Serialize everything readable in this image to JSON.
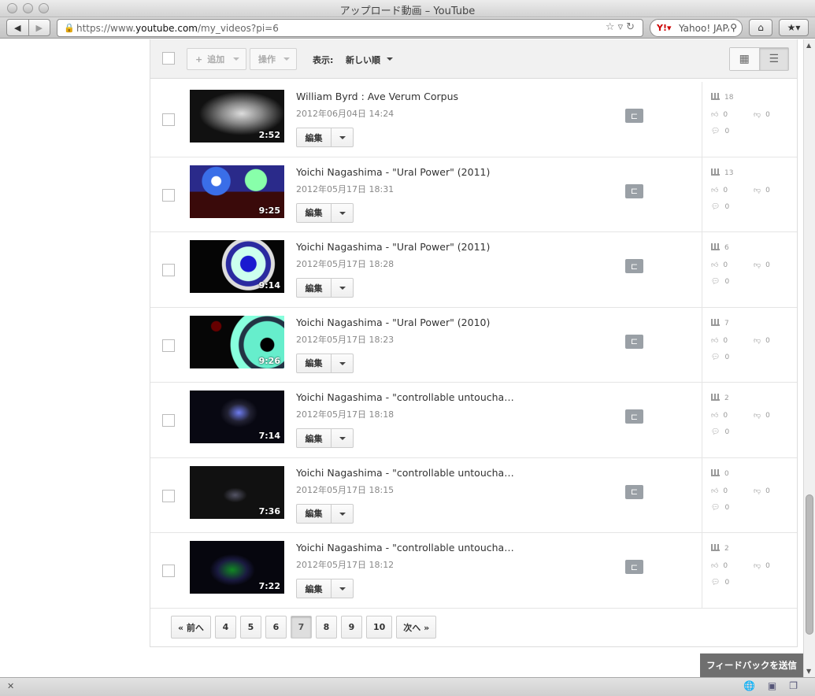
{
  "window": {
    "title": "アップロード動画 – YouTube",
    "url_prefix": "https://www.",
    "url_domain": "youtube.com",
    "url_path": "/my_videos?pi=6",
    "search_text": "Yahoo! JAPAN"
  },
  "toolbar": {
    "add_label": "追加",
    "actions_label": "操作",
    "sort_label": "表示:",
    "sort_value": "新しい順"
  },
  "videos": [
    {
      "title": "William Byrd : Ave Verum Corpus",
      "date": "2012年06月04日 14:24",
      "duration": "2:52",
      "views": "18",
      "likes": "0",
      "dislikes": "0",
      "comments": "0",
      "thumb": "choir"
    },
    {
      "title": "Yoichi Nagashima - \"Ural Power\" (2011)",
      "date": "2012年05月17日 18:31",
      "duration": "9:25",
      "views": "13",
      "likes": "0",
      "dislikes": "0",
      "comments": "0",
      "thumb": "ural-red"
    },
    {
      "title": "Yoichi Nagashima - \"Ural Power\" (2011)",
      "date": "2012年05月17日 18:28",
      "duration": "9:14",
      "views": "6",
      "likes": "0",
      "dislikes": "0",
      "comments": "0",
      "thumb": "ural-ring"
    },
    {
      "title": "Yoichi Nagashima - \"Ural Power\" (2010)",
      "date": "2012年05月17日 18:23",
      "duration": "9:26",
      "views": "7",
      "likes": "0",
      "dislikes": "0",
      "comments": "0",
      "thumb": "ural-teal"
    },
    {
      "title": "Yoichi Nagashima - \"controllable untoucha…",
      "date": "2012年05月17日 18:18",
      "duration": "7:14",
      "views": "2",
      "likes": "0",
      "dislikes": "0",
      "comments": "0",
      "thumb": "dark-blue"
    },
    {
      "title": "Yoichi Nagashima - \"controllable untoucha…",
      "date": "2012年05月17日 18:15",
      "duration": "7:36",
      "views": "0",
      "likes": "0",
      "dislikes": "0",
      "comments": "0",
      "thumb": "dark"
    },
    {
      "title": "Yoichi Nagashima - \"controllable untoucha…",
      "date": "2012年05月17日 18:12",
      "duration": "7:22",
      "views": "2",
      "likes": "0",
      "dislikes": "0",
      "comments": "0",
      "thumb": "dark-blue2"
    }
  ],
  "row_labels": {
    "edit": "編集",
    "privacy_icon": "unlock-icon"
  },
  "pagination": {
    "prev": "« 前へ",
    "pages": [
      "4",
      "5",
      "6",
      "7",
      "8",
      "9",
      "10"
    ],
    "active": "7",
    "next": "次へ »"
  },
  "feedback_label": "フィードバックを送信",
  "colors": {
    "header_bg": "#f1f1f1",
    "privacy_badge": "#9aa0a6",
    "feedback_bg": "#6f6f6f"
  }
}
